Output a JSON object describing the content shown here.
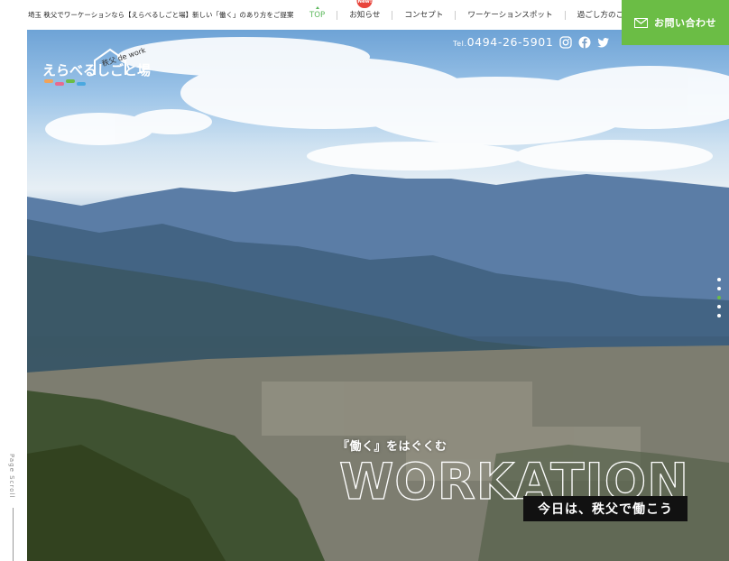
{
  "header": {
    "tagline": "埼玉 秩父でワーケーションなら【えらべるしごと場】新しい「働く」のあり方をご提案",
    "nav": [
      {
        "label": "TOP",
        "active": true
      },
      {
        "label": "お知らせ",
        "badge": "New!"
      },
      {
        "label": "コンセプト"
      },
      {
        "label": "ワーケーションスポット"
      },
      {
        "label": "過ごし方のご提案"
      }
    ],
    "contact_label": "お問い合わせ"
  },
  "logo": {
    "main_text": "えらべるしごと場",
    "sub_text": "秩父 de work"
  },
  "hero": {
    "tel_prefix": "Tel.",
    "tel_number": "0494-26-5901",
    "social_icons": [
      "instagram-icon",
      "facebook-icon",
      "twitter-icon"
    ],
    "catch": "『働く』をはぐくむ",
    "big_word": "WORKATION",
    "today_label": "今日は、秩父で働こう",
    "slide_dots": 5,
    "active_dot": 3
  },
  "side": {
    "page_scroll": "Page Scroll"
  },
  "colors": {
    "accent": "#6bbd45",
    "badge": "#e8453c"
  }
}
